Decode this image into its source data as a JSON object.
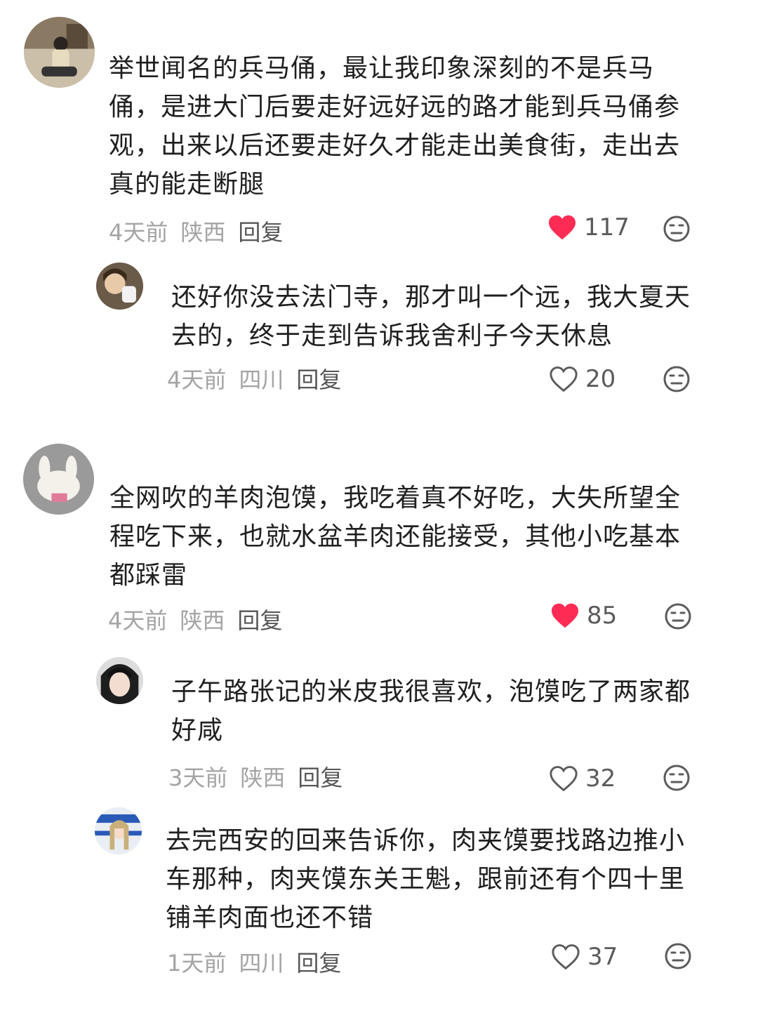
{
  "comments": [
    {
      "text": "举世闻名的兵马俑，最让我印象深刻的不是兵马俑，是进大门后要走好远好远的路才能到兵马俑参观，出来以后还要走好久才能走出美食街，走出去真的能走断腿",
      "time": "4天前",
      "location": "陕西",
      "reply_label": "回复",
      "likes": "117",
      "liked": true
    },
    {
      "text": "还好你没去法门寺，那才叫一个远，我大夏天去的，终于走到告诉我舍利子今天休息",
      "time": "4天前",
      "location": "四川",
      "reply_label": "回复",
      "likes": "20",
      "liked": false
    },
    {
      "text": "全网吹的羊肉泡馍，我吃着真不好吃，大失所望全程吃下来，也就水盆羊肉还能接受，其他小吃基本都踩雷",
      "time": "4天前",
      "location": "陕西",
      "reply_label": "回复",
      "likes": "85",
      "liked": true
    },
    {
      "text": "子午路张记的米皮我很喜欢，泡馍吃了两家都好咸",
      "time": "3天前",
      "location": "陕西",
      "reply_label": "回复",
      "likes": "32",
      "liked": false
    },
    {
      "text": "去完西安的回来告诉你，肉夹馍要找路边推小车那种，肉夹馍东关王魁，跟前还有个四十里铺羊肉面也还不错",
      "time": "1天前",
      "location": "四川",
      "reply_label": "回复",
      "likes": "37",
      "liked": false
    }
  ],
  "colors": {
    "liked_heart": "#fe2c55",
    "unliked_heart": "#5b5b5b",
    "meta_text": "#a4a4a4",
    "reply_text": "#565656"
  },
  "icons": {
    "like": "heart-icon",
    "dislike": "meh-face-icon"
  }
}
